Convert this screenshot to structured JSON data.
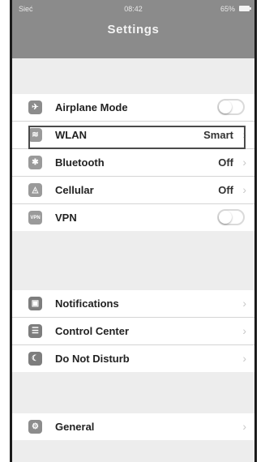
{
  "status": {
    "carrier": "Sieć",
    "time": "08:42",
    "battery": "65%"
  },
  "header": {
    "title": "Settings"
  },
  "group_network": [
    {
      "label": "Airplane Mode",
      "icon": "airplane-icon",
      "control": "toggle",
      "state": "off"
    },
    {
      "label": "WLAN",
      "icon": "wifi-icon",
      "value": "Smart"
    },
    {
      "label": "Bluetooth",
      "icon": "bluetooth-icon",
      "value": "Off"
    },
    {
      "label": "Cellular",
      "icon": "cellular-icon",
      "value": "Off"
    },
    {
      "label": "VPN",
      "icon": "vpn-icon",
      "control": "toggle",
      "state": "off"
    }
  ],
  "group_system": [
    {
      "label": "Notifications",
      "icon": "notifications-icon"
    },
    {
      "label": "Control Center",
      "icon": "control-center-icon"
    },
    {
      "label": "Do Not Disturb",
      "icon": "moon-icon"
    }
  ],
  "group_general": [
    {
      "label": "General",
      "icon": "gear-icon"
    }
  ],
  "icon_glyphs": {
    "airplane": "✈",
    "wifi": "≋",
    "bluetooth": "✱",
    "cellular": "◬",
    "vpn": "VPN",
    "notifications": "▣",
    "control_center": "☰",
    "moon": "☾",
    "gear": "⚙",
    "chevron": "›"
  },
  "colors": {
    "header": "#8b8b8b",
    "background": "#ededed",
    "icon_gray": "#9a9a9a",
    "icon_dark": "#7d7d7d"
  }
}
